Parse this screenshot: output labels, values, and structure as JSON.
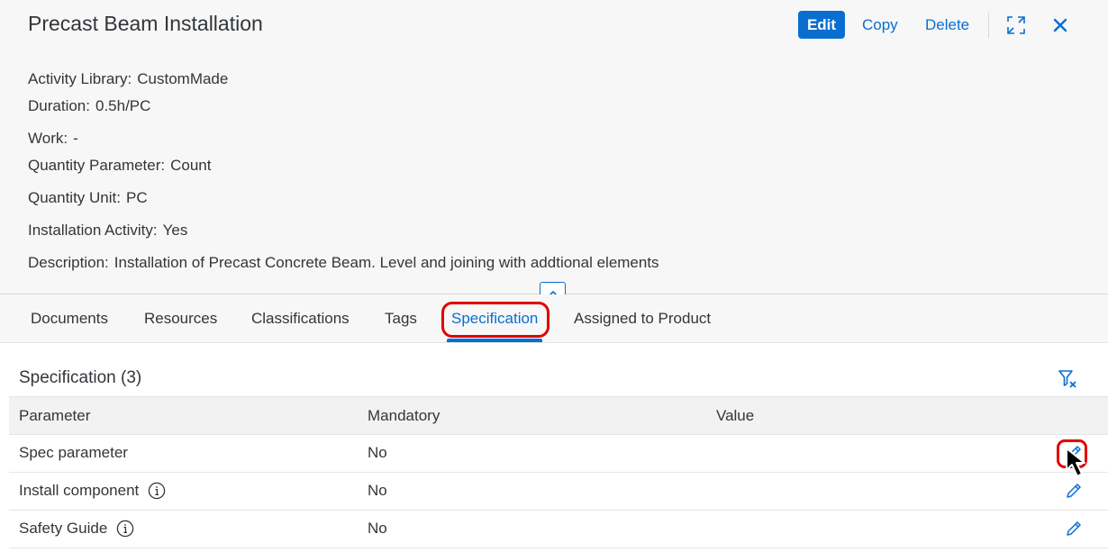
{
  "header": {
    "title": "Precast Beam Installation",
    "edit_label": "Edit",
    "copy_label": "Copy",
    "delete_label": "Delete",
    "expand_icon": "exit-full-screen-icon",
    "close_icon": "close-icon"
  },
  "details": [
    {
      "label": "Activity Library:",
      "value": "CustomMade"
    },
    {
      "label": "Duration:",
      "value": "0.5h/PC"
    },
    {
      "label": "Work:",
      "value": "-"
    },
    {
      "label": "Quantity Parameter:",
      "value": "Count"
    },
    {
      "label": "Quantity Unit:",
      "value": "PC"
    },
    {
      "label": "Installation Activity:",
      "value": "Yes"
    },
    {
      "label": "Description:",
      "value": "Installation of Precast Concrete Beam. Level and joining with addtional elements"
    }
  ],
  "tabs": [
    {
      "label": "Documents"
    },
    {
      "label": "Resources"
    },
    {
      "label": "Classifications"
    },
    {
      "label": "Tags"
    },
    {
      "label": "Specification",
      "active": true
    },
    {
      "label": "Assigned to Product"
    }
  ],
  "specification": {
    "title": "Specification (3)",
    "columns": [
      "Parameter",
      "Mandatory",
      "Value"
    ],
    "rows": [
      {
        "parameter": "Spec parameter",
        "mandatory": "No",
        "value": "",
        "info": false
      },
      {
        "parameter": "Install component",
        "mandatory": "No",
        "value": "",
        "info": true
      },
      {
        "parameter": "Safety Guide",
        "mandatory": "No",
        "value": "",
        "info": true
      }
    ]
  },
  "colors": {
    "accent": "#0a6ed1",
    "highlight": "#e30000",
    "text": "#32363a",
    "header_bg": "#f7f7f7"
  }
}
